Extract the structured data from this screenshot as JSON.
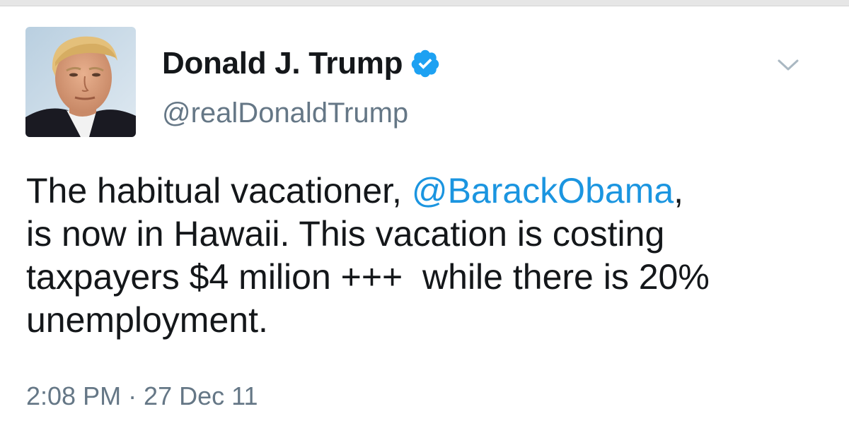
{
  "tweet": {
    "author": {
      "display_name": "Donald J. Trump",
      "handle": "@realDonaldTrump",
      "verified": true,
      "avatar_icon": "profile-photo"
    },
    "menu_icon": "chevron-down-icon",
    "text": {
      "line1_pre": "The habitual vacationer, ",
      "mention": "@BarackObama",
      "line1_post": ",",
      "line2": "is now in Hawaii. This vacation is costing",
      "line3": "taxpayers $4 milion +++  while there is 20%",
      "line4": "unemployment."
    },
    "timestamp": "2:08 PM · 27 Dec 11"
  },
  "colors": {
    "text": "#14171a",
    "secondary": "#657786",
    "link": "#1b95e0",
    "verified": "#1da1f2"
  }
}
